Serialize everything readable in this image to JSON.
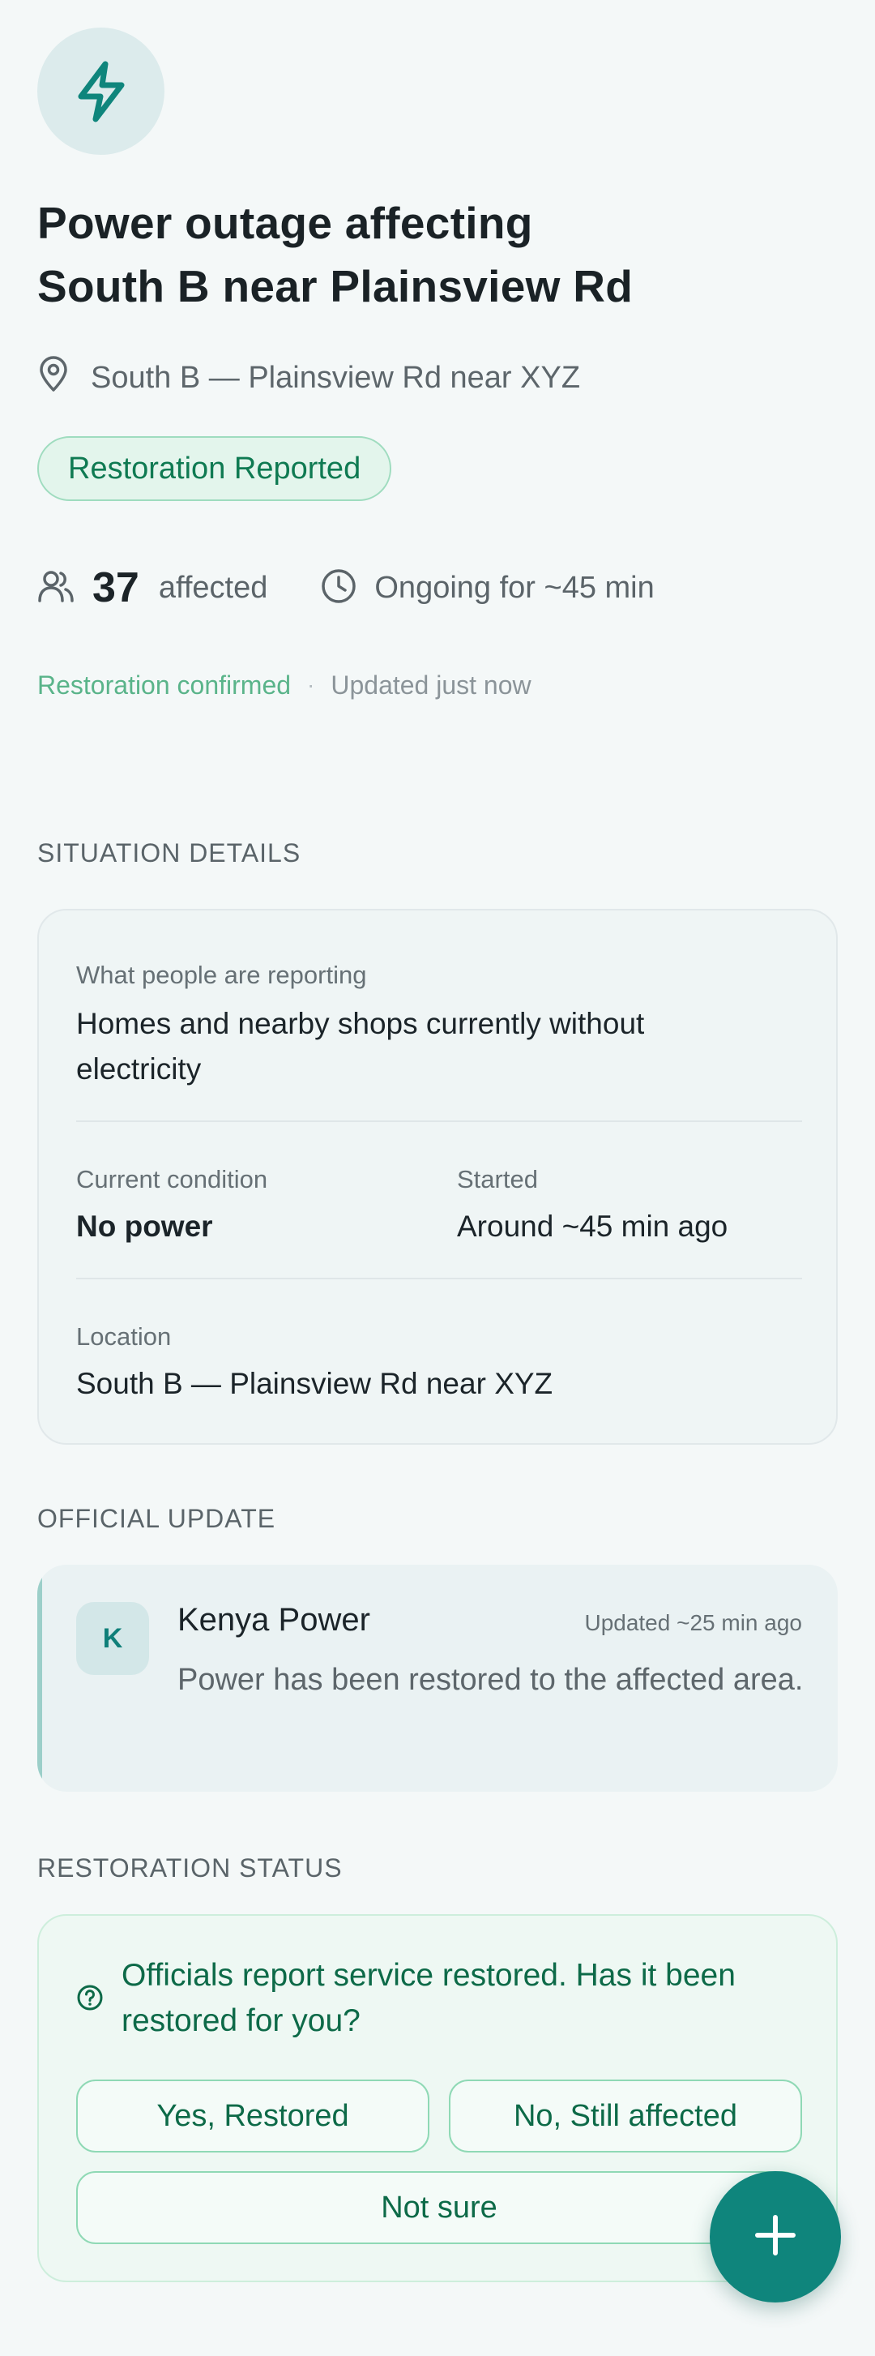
{
  "incident": {
    "icon": "lightning-icon",
    "title_line1": "Power outage affecting",
    "title_line2": "South B near Plainsview Rd",
    "location": "South B — Plainsview Rd near XYZ",
    "status_badge": "Restoration Reported",
    "affected_count": "37",
    "affected_label": "affected",
    "duration": "Ongoing for ~45 min",
    "confirmation": "Restoration confirmed",
    "meta_separator": "·",
    "updated": "Updated just now"
  },
  "situation": {
    "heading": "SITUATION DETAILS",
    "reporting_label": "What people are reporting",
    "reporting_line1": "Homes and nearby shops currently without",
    "reporting_line2": "electricity",
    "condition_label": "Current condition",
    "condition_value": "No power",
    "started_label": "Started",
    "started_value": "Around ~45 min ago",
    "location_label": "Location",
    "location_value": "South B — Plainsview Rd near XYZ"
  },
  "official": {
    "heading": "OFFICIAL UPDATE",
    "avatar_letter": "K",
    "org": "Kenya Power",
    "updated": "Updated ~25 min ago",
    "message": "Power has been restored to the affected area."
  },
  "restoration": {
    "heading": "RESTORATION STATUS",
    "question_line1": "Officials report service restored. Has it been",
    "question_line2": "restored for you?",
    "yes_label": "Yes, Restored",
    "no_label": "No, Still affected",
    "unsure_label": "Not sure"
  },
  "fab": {
    "icon": "plus-icon"
  },
  "colors": {
    "background": "#f4f8f8",
    "accent": "#0f857c",
    "status_green": "#0f7a52",
    "confirmed_green": "#5ab48a"
  }
}
